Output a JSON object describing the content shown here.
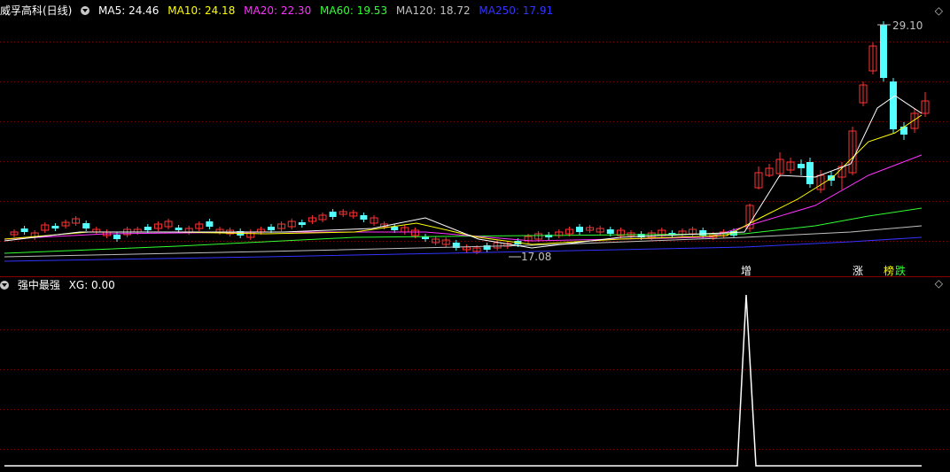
{
  "header": {
    "title": "威孚高科(日线)",
    "ma": [
      {
        "label": "MA5: 24.46",
        "color": "#ffffff"
      },
      {
        "label": "MA10: 24.18",
        "color": "#ffff00"
      },
      {
        "label": "MA20: 22.30",
        "color": "#ff33ff"
      },
      {
        "label": "MA60: 19.53",
        "color": "#33ff33"
      },
      {
        "label": "MA120: 18.72",
        "color": "#c0c0c0"
      },
      {
        "label": "MA250: 17.91",
        "color": "#3333ff"
      }
    ]
  },
  "sub": {
    "title": "强中最强",
    "value": "XG: 0.00"
  },
  "labels": {
    "high": "29.10",
    "low": "17.08",
    "up_icon": "chevron-up-icon",
    "down_icon": "chevron-down-icon"
  },
  "signals": [
    {
      "text": "增",
      "color": "#ffffff"
    },
    {
      "text": "涨",
      "color": "#ffffff"
    },
    {
      "text": "榜",
      "color": "#ffff00"
    },
    {
      "text": "跌",
      "color": "#33ff33"
    }
  ],
  "colors": {
    "up": "#ff3333",
    "down": "#54ffff",
    "grid": "#8b0000"
  }
}
